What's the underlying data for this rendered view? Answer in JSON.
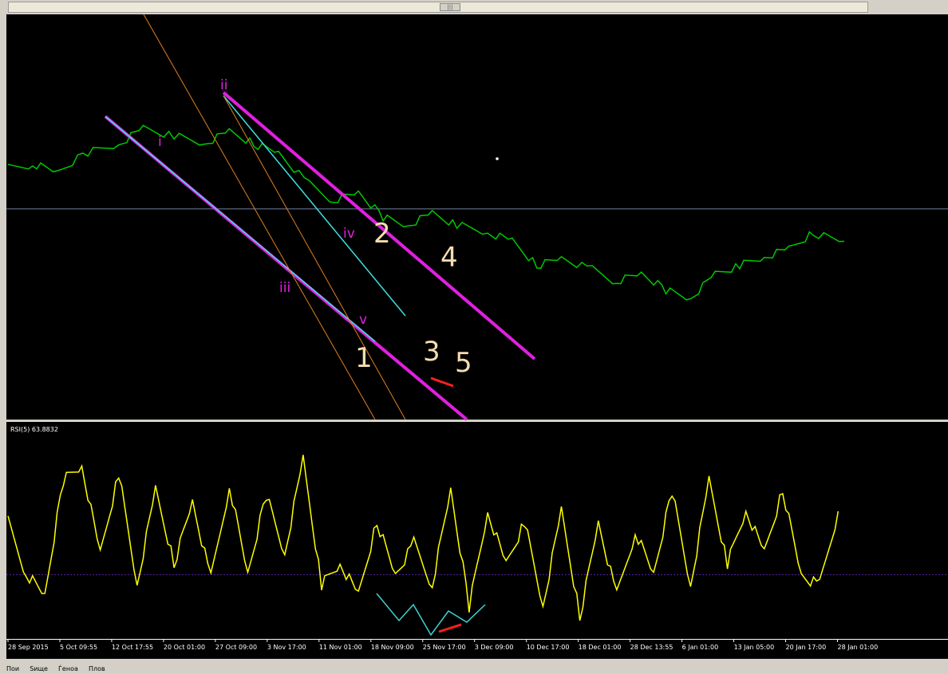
{
  "chart_data": [
    {
      "type": "line",
      "pane": "price",
      "series": [
        {
          "color": "#00c800",
          "x": [
            0,
            4,
            8,
            13,
            18,
            22,
            27,
            32,
            36,
            40,
            44,
            49,
            53,
            57,
            61,
            65,
            69,
            73,
            78,
            82,
            86,
            90,
            95,
            99,
            103,
            107,
            111,
            115,
            119,
            123,
            127,
            131,
            136
          ],
          "y": [
            62,
            63,
            61,
            66,
            68,
            72,
            70,
            68,
            71,
            68,
            66,
            58,
            54,
            56,
            50,
            48,
            51,
            48,
            46,
            44,
            38,
            40,
            37,
            34,
            36,
            32,
            30,
            36,
            38,
            40,
            42,
            46,
            44
          ]
        }
      ],
      "xlim": [
        0,
        136
      ],
      "ylim": [
        0,
        100
      ],
      "x_tick_labels": [
        "28 Sep 2015",
        "5 Oct 09:55",
        "12 Oct 17:55",
        "20 Oct 01:00",
        "27 Oct 09:00",
        "3 Nov 17:00",
        "11 Nov 01:00",
        "18 Nov 09:00",
        "25 Nov 17:00",
        "3 Dec 09:00",
        "10 Dec 17:00",
        "18 Dec 01:00",
        "28 Dec 13:55",
        "6 Jan 01:00",
        "13 Jan 05:00",
        "20 Jan 17:00",
        "28 Jan 01:00"
      ],
      "horizontal_line": 52,
      "annotations": [
        {
          "text": "i",
          "color": "#e020e0"
        },
        {
          "text": "ii",
          "color": "#e020e0"
        },
        {
          "text": "iii",
          "color": "#e020e0"
        },
        {
          "text": "iv",
          "color": "#e020e0"
        },
        {
          "text": "v",
          "color": "#e020e0"
        },
        {
          "text": "1",
          "color": "#f5ddb0"
        },
        {
          "text": "2",
          "color": "#f5ddb0"
        },
        {
          "text": "3",
          "color": "#f5ddb0"
        },
        {
          "text": "4",
          "color": "#f5ddb0"
        },
        {
          "text": "5",
          "color": "#f5ddb0"
        }
      ]
    },
    {
      "type": "line",
      "pane": "rsi",
      "title": "RSI(5) 63.8832",
      "series": [
        {
          "color": "#ffff00",
          "x": [
            0,
            3,
            6,
            9,
            12,
            15,
            18,
            21,
            24,
            27,
            30,
            33,
            36,
            39,
            42,
            45,
            48,
            51,
            54,
            57,
            60,
            63,
            66,
            69,
            72,
            75,
            78,
            81,
            84,
            87,
            90,
            93,
            96,
            99,
            102,
            105,
            108,
            111,
            114,
            117,
            120,
            123,
            126,
            129,
            132,
            135
          ],
          "y": [
            55,
            30,
            20,
            75,
            82,
            40,
            78,
            25,
            70,
            35,
            65,
            28,
            72,
            30,
            68,
            40,
            85,
            25,
            35,
            20,
            55,
            30,
            45,
            25,
            70,
            15,
            60,
            35,
            55,
            15,
            60,
            10,
            55,
            20,
            50,
            30,
            70,
            25,
            75,
            35,
            60,
            40,
            70,
            30,
            25,
            60
          ]
        }
      ],
      "xlim": [
        0,
        136
      ],
      "ylim": [
        0,
        100
      ],
      "horizontal_line": 30
    }
  ],
  "ui": {
    "scroll_thumb_glyph": "|||",
    "bottom_tabs": [
      "Пои",
      "Ѕище",
      "Ѓеноа",
      "Плов"
    ]
  }
}
